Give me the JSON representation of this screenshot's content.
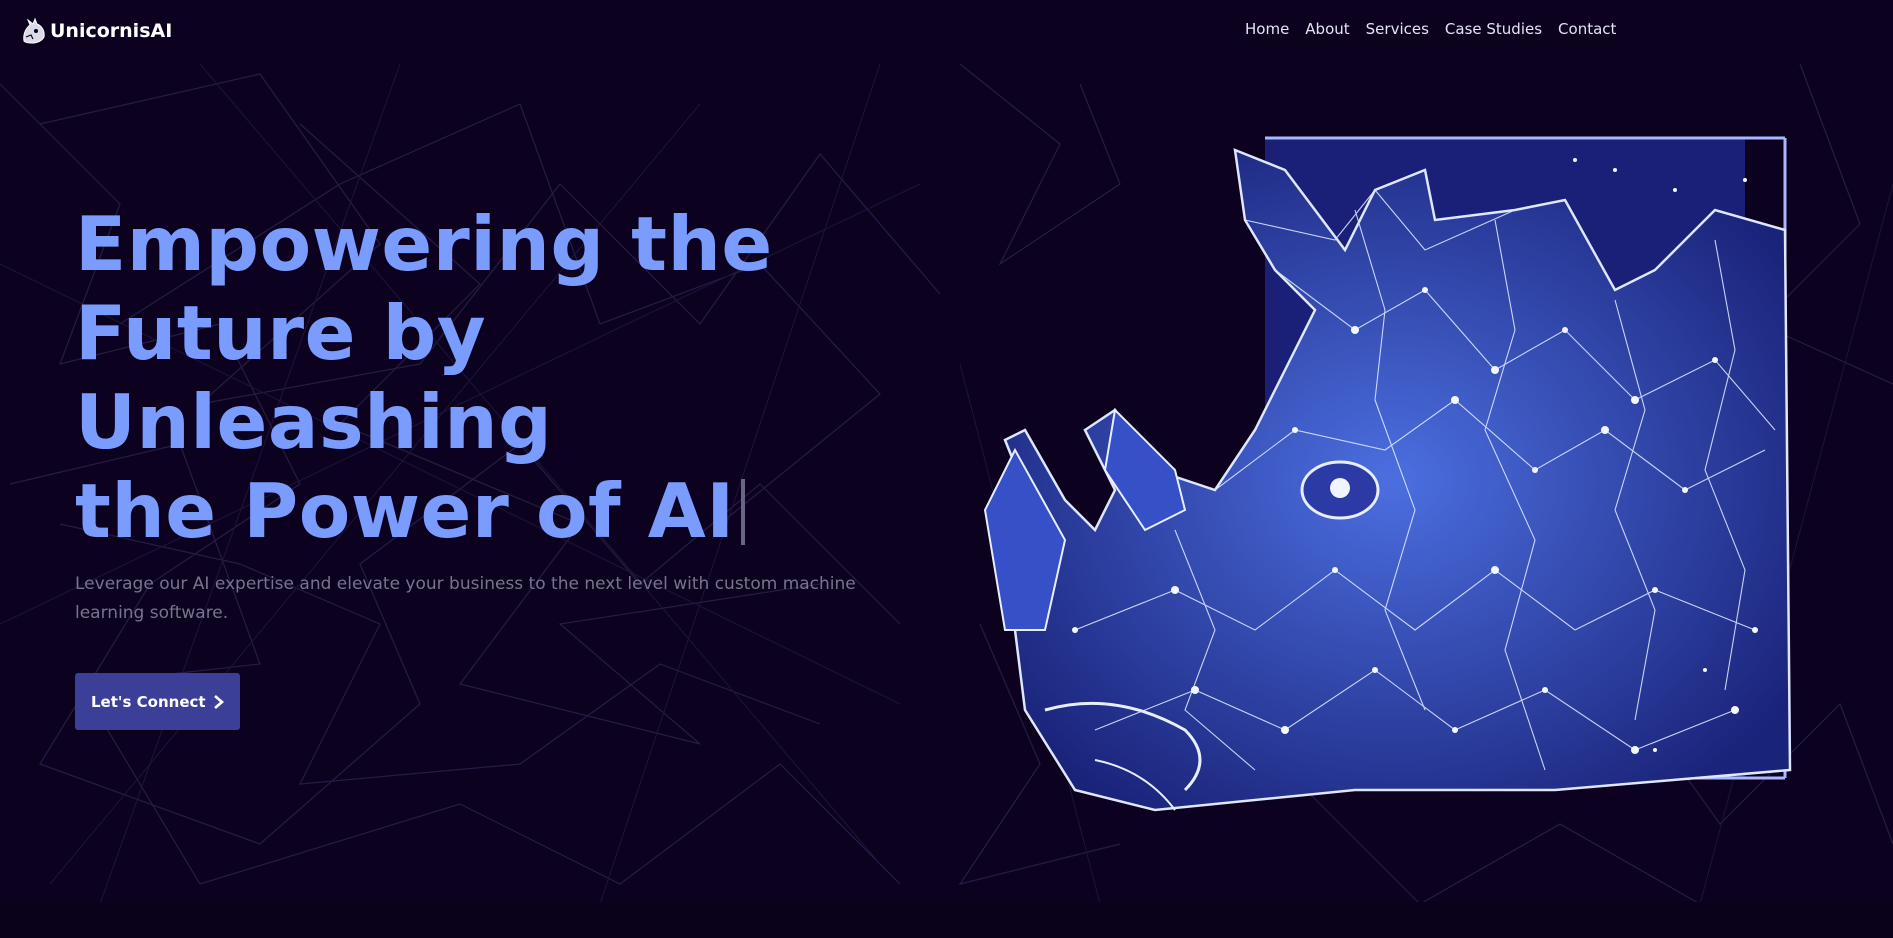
{
  "brand": {
    "name": "UnicornisAI",
    "logo_icon": "rhino-head-icon"
  },
  "nav": {
    "items": [
      {
        "label": "Home"
      },
      {
        "label": "About"
      },
      {
        "label": "Services"
      },
      {
        "label": "Case Studies"
      },
      {
        "label": "Contact"
      }
    ]
  },
  "hero": {
    "title_line1": "Empowering the",
    "title_line2": "Future by Unleashing",
    "title_line3": "the Power of AI",
    "subtitle": "Leverage our AI expertise and elevate your business to the next level with custom machine learning software.",
    "cta_label": "Let's Connect",
    "cta_icon": "chevron-right-icon"
  },
  "artwork": {
    "icon": "geometric-rhino-illustration"
  },
  "colors": {
    "background": "#0c0220",
    "headline": "#7b9cff",
    "button": "#3c3f97",
    "subtitle": "#77748e"
  }
}
